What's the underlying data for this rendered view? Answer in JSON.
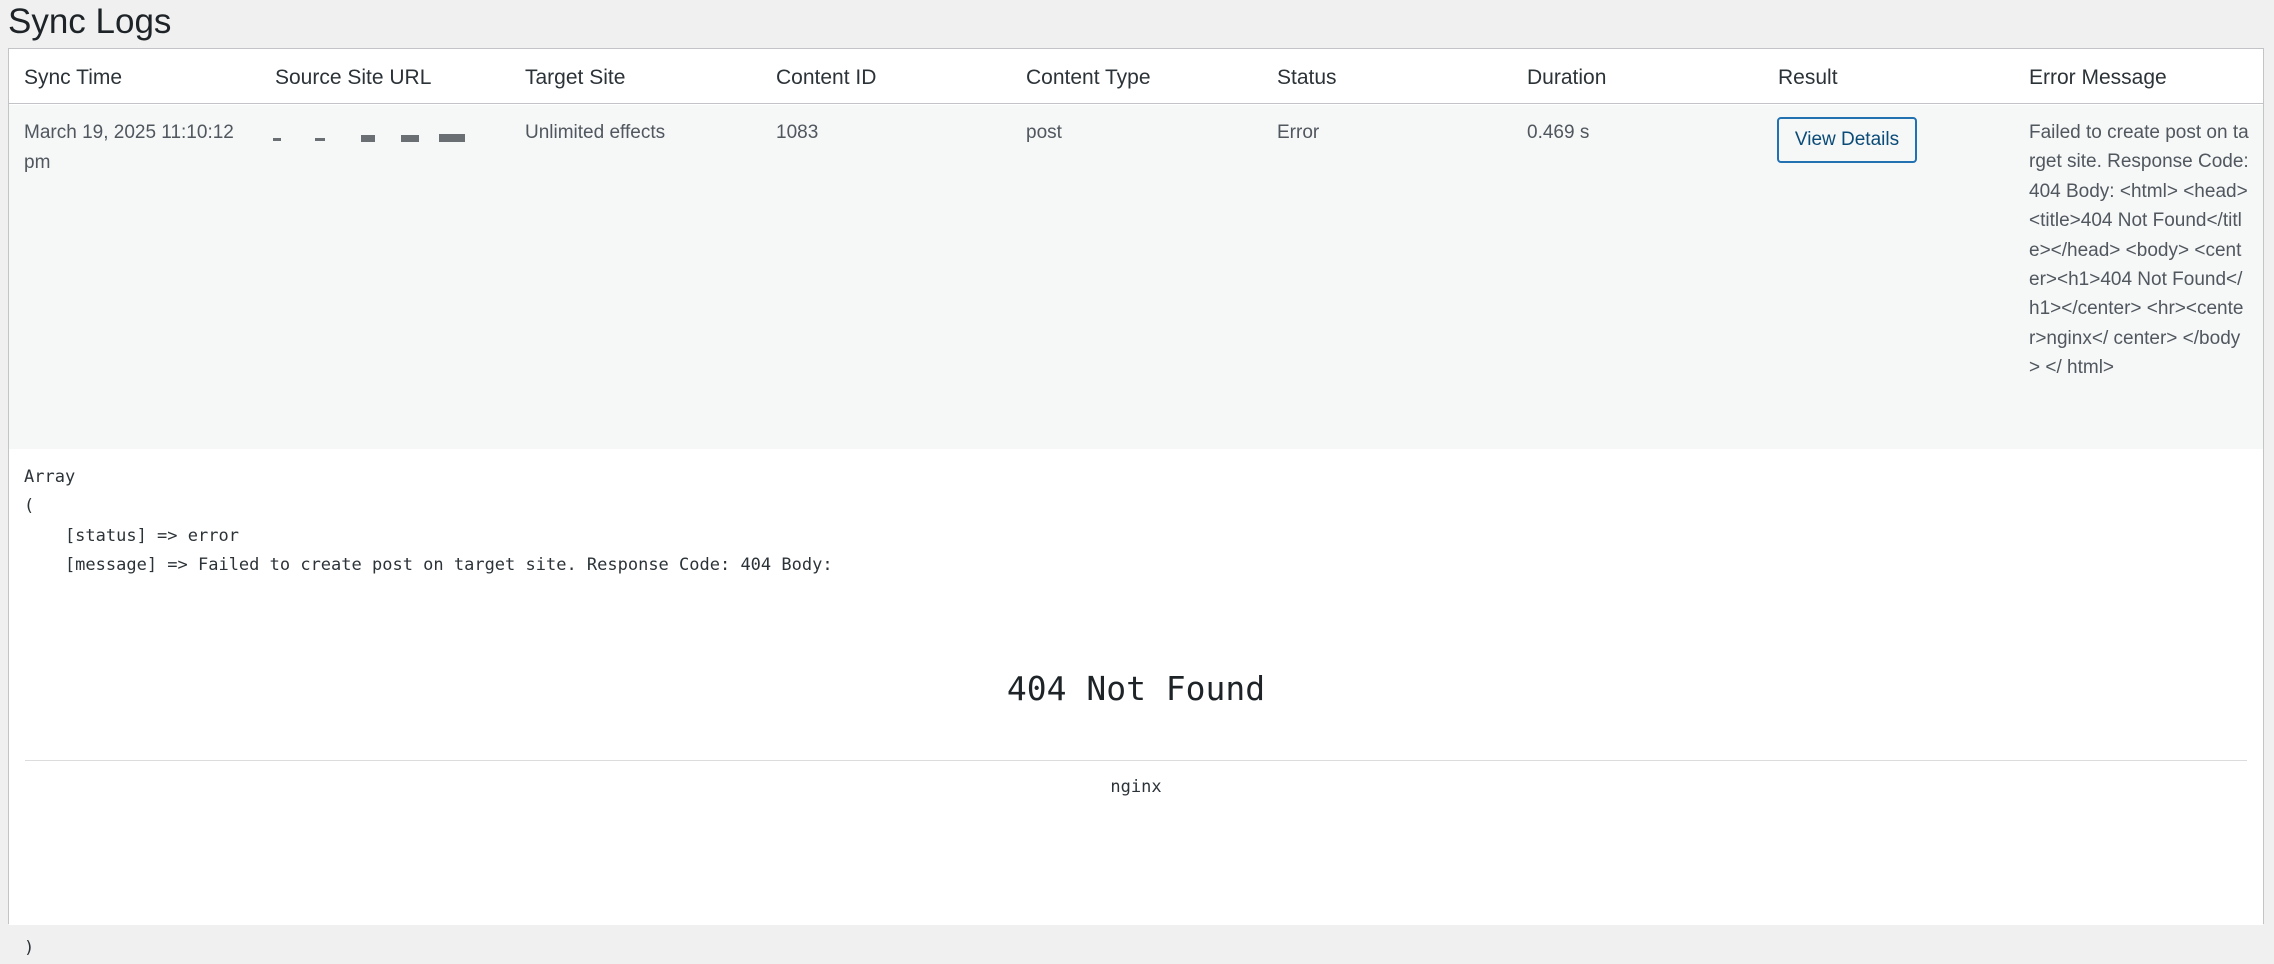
{
  "page": {
    "title": "Sync Logs"
  },
  "table": {
    "columns": [
      "Sync Time",
      "Source Site URL",
      "Target Site",
      "Content ID",
      "Content Type",
      "Status",
      "Duration",
      "Result",
      "Error Message"
    ],
    "row": {
      "sync_time_line1": "March 19, 2025 11:10:12",
      "sync_time_line2": "pm",
      "target_site": "Unlimited effects",
      "content_id": "1083",
      "content_type": "post",
      "status": "Error",
      "duration": "0.469 s",
      "result_button": "View Details",
      "error_message": "Failed to create post on target site. Response Code: 404 Body: <html> <head><title>404 Not Found</title></head> <body> <center><h1>404 Not Found</h1></center> <hr><center>nginx</ center> </body> </ html>"
    }
  },
  "details": {
    "line_array": "Array",
    "line_open": "(",
    "line_status": "    [status] => error",
    "line_message": "    [message] => Failed to create post on target site. Response Code: 404 Body: ",
    "not_found_heading": "404 Not Found",
    "server_name": "nginx",
    "line_close": ")"
  },
  "colors": {
    "accent": "#2271b1",
    "row_background": "#f6f7f7",
    "page_background": "#f0f0f1"
  }
}
